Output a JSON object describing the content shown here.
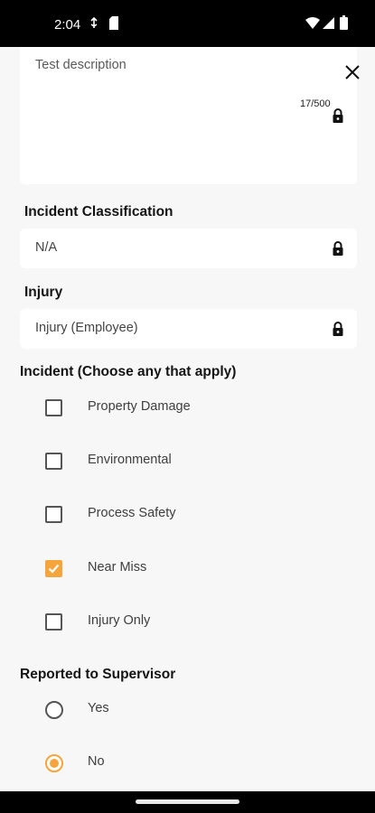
{
  "status_bar": {
    "time": "2:04"
  },
  "form": {
    "description": {
      "value": "Test description",
      "char_count": "17/500"
    },
    "incident_classification": {
      "label": "Incident Classification",
      "value": "N/A"
    },
    "injury": {
      "label": "Injury",
      "value": "Injury (Employee)"
    },
    "incident_types": {
      "label": "Incident (Choose any that apply)",
      "options": [
        {
          "label": "Property Damage",
          "checked": false
        },
        {
          "label": "Environmental",
          "checked": false
        },
        {
          "label": "Process Safety",
          "checked": false
        },
        {
          "label": "Near Miss",
          "checked": true
        },
        {
          "label": "Injury Only",
          "checked": false
        }
      ]
    },
    "reported_to_supervisor": {
      "label": "Reported to Supervisor",
      "options": [
        {
          "label": "Yes",
          "selected": false
        },
        {
          "label": "No",
          "selected": true
        }
      ]
    }
  },
  "icons": {
    "close": "close-icon",
    "lock": "lock-icon"
  },
  "colors": {
    "accent": "#f5a53c",
    "background": "#f7f7f7",
    "field": "#ffffff"
  }
}
